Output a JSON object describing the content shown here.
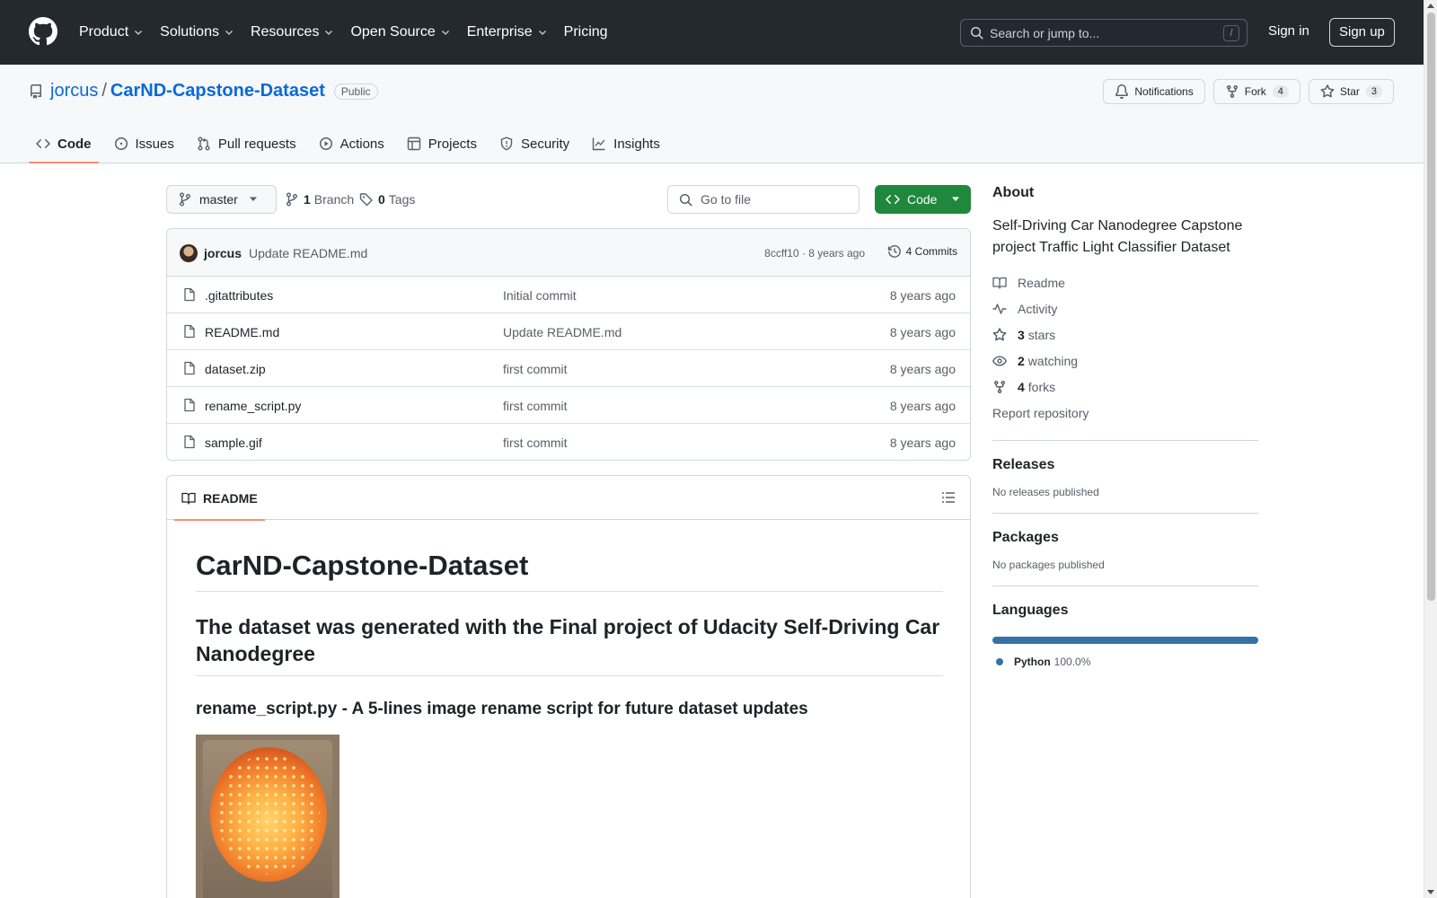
{
  "header": {
    "nav": [
      {
        "label": "Product",
        "dropdown": true
      },
      {
        "label": "Solutions",
        "dropdown": true
      },
      {
        "label": "Resources",
        "dropdown": true
      },
      {
        "label": "Open Source",
        "dropdown": true
      },
      {
        "label": "Enterprise",
        "dropdown": true
      },
      {
        "label": "Pricing",
        "dropdown": false
      }
    ],
    "search_placeholder": "Search or jump to...",
    "search_shortcut": "/",
    "sign_in": "Sign in",
    "sign_up": "Sign up"
  },
  "repo": {
    "owner": "jorcus",
    "separator": "/",
    "name": "CarND-Capstone-Dataset",
    "visibility": "Public",
    "notifications_label": "Notifications",
    "fork_label": "Fork",
    "fork_count": "4",
    "star_label": "Star",
    "star_count": "3"
  },
  "tabs": [
    {
      "label": "Code",
      "icon": "code-icon",
      "active": true
    },
    {
      "label": "Issues",
      "icon": "issue-icon",
      "active": false
    },
    {
      "label": "Pull requests",
      "icon": "pull-request-icon",
      "active": false
    },
    {
      "label": "Actions",
      "icon": "play-icon",
      "active": false
    },
    {
      "label": "Projects",
      "icon": "table-icon",
      "active": false
    },
    {
      "label": "Security",
      "icon": "shield-icon",
      "active": false
    },
    {
      "label": "Insights",
      "icon": "graph-icon",
      "active": false
    }
  ],
  "branchbar": {
    "branch": "master",
    "branch_count": "1",
    "branch_label": "Branch",
    "tag_count": "0",
    "tag_label": "Tags",
    "go_to_file": "Go to file",
    "code_button": "Code"
  },
  "latest_commit": {
    "author": "jorcus",
    "message": "Update README.md",
    "hash_age": "8ccff10 · 8 years ago",
    "commits_label": "4 Commits"
  },
  "files": [
    {
      "name": ".gitattributes",
      "message": "Initial commit",
      "age": "8 years ago"
    },
    {
      "name": "README.md",
      "message": "Update README.md",
      "age": "8 years ago"
    },
    {
      "name": "dataset.zip",
      "message": "first commit",
      "age": "8 years ago"
    },
    {
      "name": "rename_script.py",
      "message": "first commit",
      "age": "8 years ago"
    },
    {
      "name": "sample.gif",
      "message": "first commit",
      "age": "8 years ago"
    }
  ],
  "readme": {
    "tab_label": "README",
    "h1": "CarND-Capstone-Dataset",
    "h2": "The dataset was generated with the Final project of Udacity Self-Driving Car Nanodegree",
    "h3": "rename_script.py - A 5-lines image rename script for future dataset updates"
  },
  "sidebar": {
    "about_title": "About",
    "description": "Self-Driving Car Nanodegree Capstone project Traffic Light Classifier Dataset",
    "readme_link": "Readme",
    "activity_link": "Activity",
    "stars_count": "3",
    "stars_label": "stars",
    "watching_count": "2",
    "watching_label": "watching",
    "forks_count": "4",
    "forks_label": "forks",
    "report": "Report repository",
    "releases_title": "Releases",
    "releases_empty": "No releases published",
    "packages_title": "Packages",
    "packages_empty": "No packages published",
    "languages_title": "Languages",
    "languages": [
      {
        "name": "Python",
        "percent": "100.0%",
        "fraction": 1.0,
        "color": "#3572A5"
      }
    ]
  },
  "colors": {
    "header_bg": "#24292f",
    "link": "#0969da",
    "code_button_bg": "#1f883d",
    "active_tab_underline": "#fd8c73"
  }
}
